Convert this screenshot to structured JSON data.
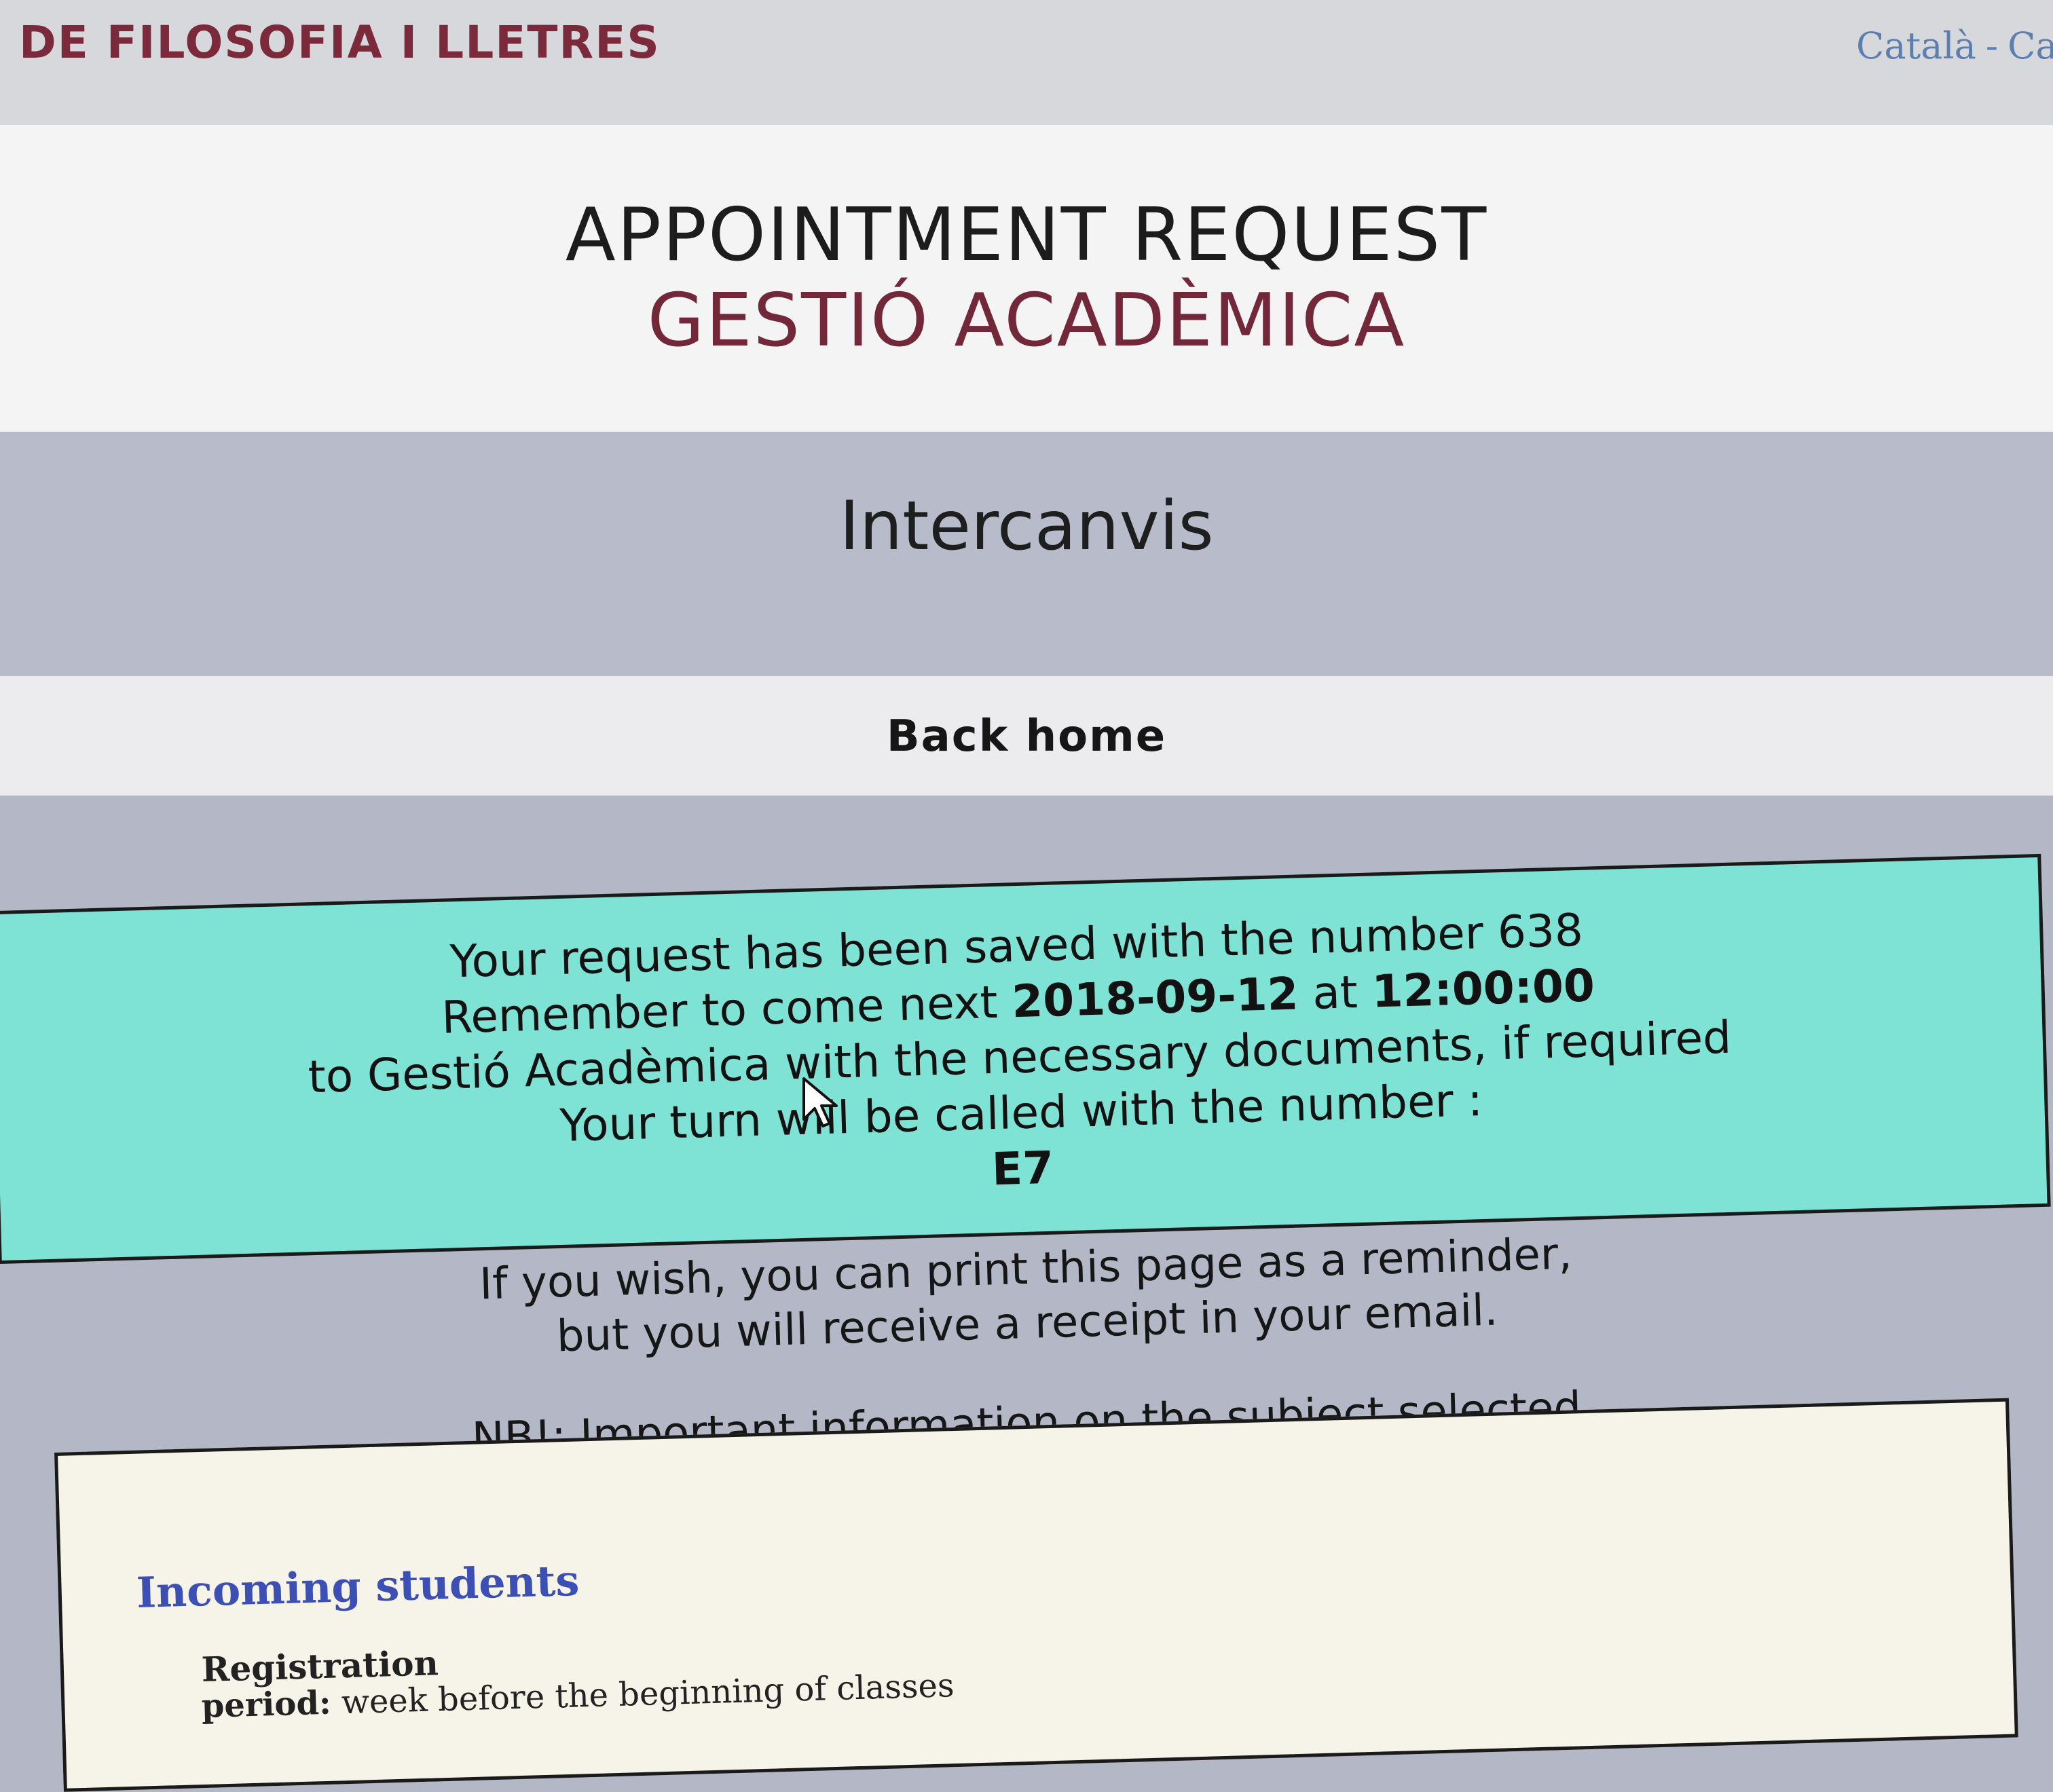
{
  "topbar": {
    "faculty": "DE FILOSOFIA I LLETRES",
    "lang_1": "Català",
    "lang_sep": "-",
    "lang_2": "Ca"
  },
  "header": {
    "title": "APPOINTMENT REQUEST",
    "subtitle": "GESTIÓ ACADÈMICA"
  },
  "section": {
    "name": "Intercanvis"
  },
  "nav": {
    "back_home": "Back home"
  },
  "notice": {
    "line1": "Your request has been saved with the number 638",
    "line2_prefix": "Remember to come next ",
    "date": "2018-09-12",
    "line2_mid": " at ",
    "time": "12:00:00",
    "line3": "to Gestió Acadèmica with the necessary documents, if required",
    "line4": "Your turn will be called with the number :",
    "turn_number": "E7"
  },
  "print_note": {
    "line1": "If you wish, you can print this page as a reminder,",
    "line2": "but you will receive a receipt in your email."
  },
  "nb": {
    "text": "NB!: Important information on the subject selected"
  },
  "info": {
    "heading": "Incoming students",
    "registration": "Registration",
    "period_label": "period:",
    "period_text": " week before the beginning of classes"
  },
  "colors": {
    "faculty": "#7b2a3c",
    "subtitle": "#73283a",
    "notice_bg": "#7ee2d4",
    "info_heading": "#3c4fb4",
    "lang_link": "#5d7fb0"
  }
}
